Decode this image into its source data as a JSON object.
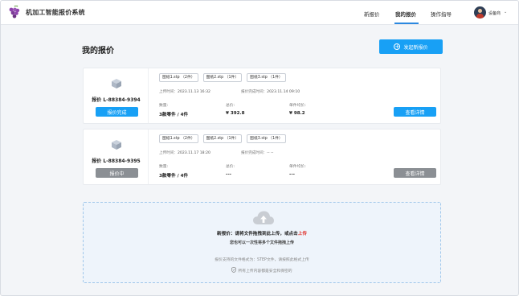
{
  "header": {
    "brand": "机加工智能报价系统",
    "nav": [
      {
        "label": "新报价"
      },
      {
        "label": "我的报价"
      },
      {
        "label": "操作指导"
      }
    ],
    "user": {
      "name": "设备商"
    }
  },
  "page": {
    "title": "我的报价",
    "new_quote_button": "发起新报价"
  },
  "quotes": [
    {
      "id": "报价 L-88384-9394",
      "status": "报价完成",
      "files": [
        "图纸1.stp （2件）",
        "图纸2.stp （1件）",
        "图纸3.stp （1件）"
      ],
      "upload_label": "上传时间：",
      "upload_time": "2023.11.13 16:32",
      "done_label": "报价完成时间：",
      "done_time": "2023.11.14 09:10",
      "qty_label": "数量:",
      "qty": "3款零件 / 4件",
      "total_label": "总价:",
      "total": "¥ 392.8",
      "unit_label": "单件均价:",
      "unit": "¥ 98.2",
      "detail_button": "查看详情"
    },
    {
      "id": "报价 L-88384-9395",
      "status": "报价中",
      "files": [
        "图纸1.stp （2件）",
        "图纸2.stp （1件）",
        "图纸3.stp （1件）"
      ],
      "upload_label": "上传时间：",
      "upload_time": "2023.11.17 18:20",
      "done_label": "报价完成时间：",
      "done_time": "-- --",
      "qty_label": "数量:",
      "qty": "3款零件 / 4件",
      "total_label": "总价:",
      "total": "---",
      "unit_label": "单件均价:",
      "unit": "---",
      "detail_button": "查看详情"
    }
  ],
  "upload": {
    "line1_prefix": "新报价：请将文件拖拽到此上传，或点击",
    "line1_link": "上传",
    "line2": "您也可以一次性将多个文件拖拽上传",
    "line3": "报价支持的文件格式为：STEP文件，请按照此格式上传",
    "line4": "所有上传内容都是安全和保密的"
  },
  "colors": {
    "primary": "#18a0f5",
    "pending": "#8b8f94",
    "link_red": "#e0302a"
  }
}
